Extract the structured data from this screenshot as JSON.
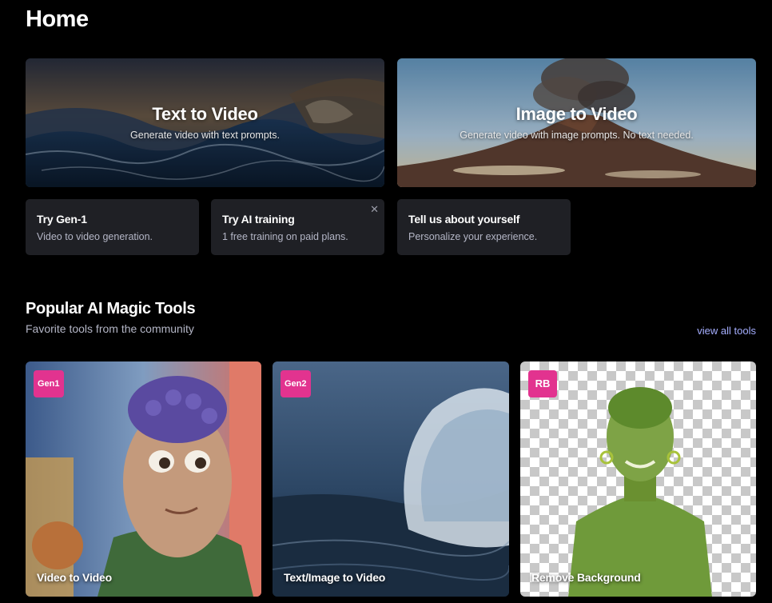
{
  "page": {
    "title": "Home"
  },
  "hero_cards": [
    {
      "title": "Text to Video",
      "subtitle": "Generate video with text prompts."
    },
    {
      "title": "Image to Video",
      "subtitle": "Generate video with image prompts. No text needed."
    }
  ],
  "quick_cards": [
    {
      "title": "Try Gen-1",
      "description": "Video to video generation."
    },
    {
      "title": "Try AI training",
      "description": "1 free training on paid plans.",
      "close_icon": "close-icon"
    },
    {
      "title": "Tell us about yourself",
      "description": "Personalize your experience."
    }
  ],
  "tools_section": {
    "title": "Popular AI Magic Tools",
    "subtitle": "Favorite tools from the community",
    "view_all_label": "view all tools"
  },
  "tools": [
    {
      "badge": "Gen1",
      "label": "Video to Video"
    },
    {
      "badge": "Gen2",
      "label": "Text/Image to Video"
    },
    {
      "badge": "RB",
      "label": "Remove Background"
    }
  ],
  "colors": {
    "background": "#000000",
    "card": "#1f2025",
    "badge": "#e2338f",
    "link": "#a5aeff",
    "muted_text": "#b4b6c6"
  }
}
